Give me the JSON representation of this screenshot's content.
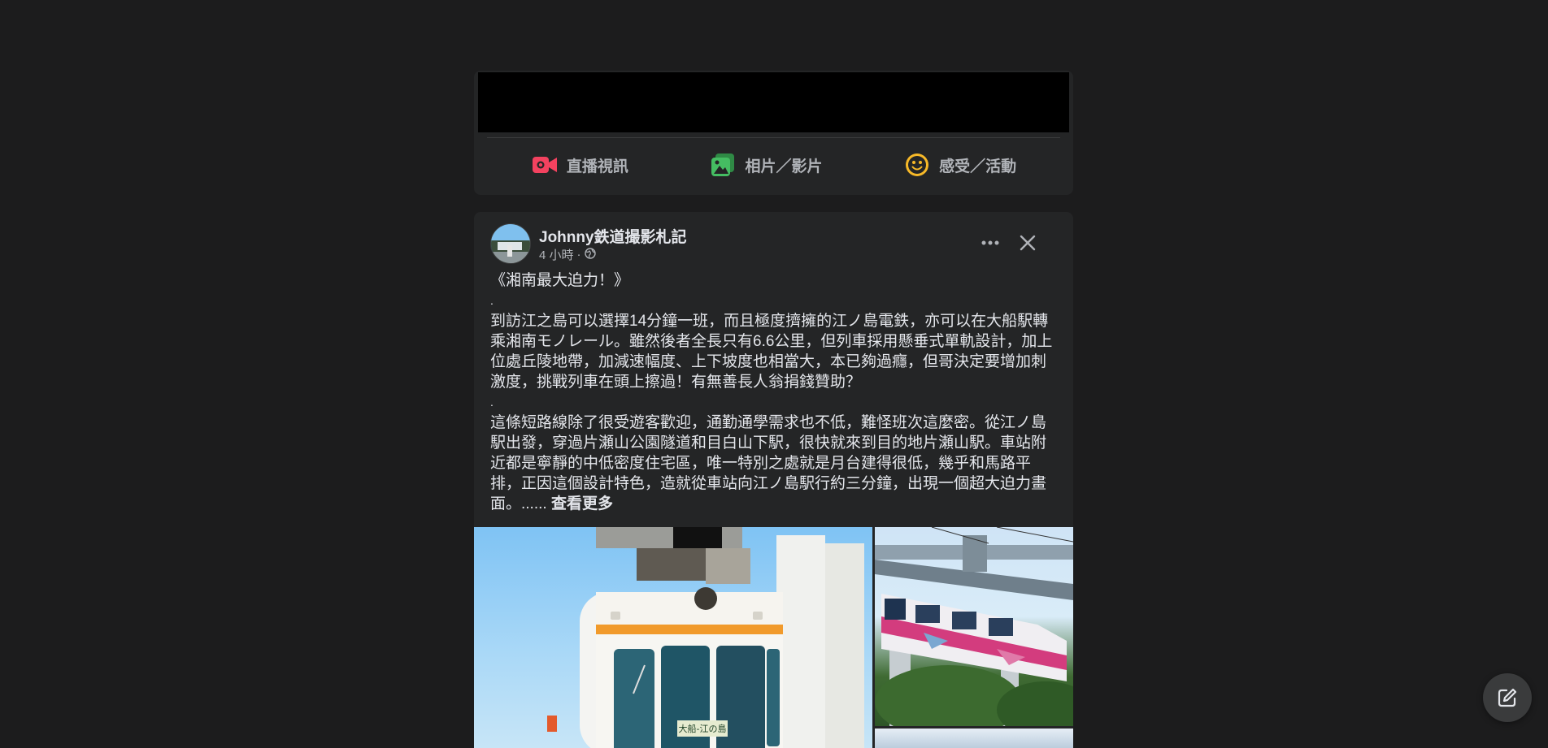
{
  "composer": {
    "actions": [
      {
        "label": "直播視訊",
        "icon": "live-video-icon"
      },
      {
        "label": "相片／影片",
        "icon": "photo-video-icon"
      },
      {
        "label": "感受／活動",
        "icon": "feeling-activity-icon"
      }
    ]
  },
  "post": {
    "author": "Johnny鉄道撮影札記",
    "time": "4 小時",
    "separator": "·",
    "privacy_icon": "globe-icon",
    "paragraphs": [
      "《湘南最大迫力！》",
      ".",
      "到訪江之島可以選擇14分鐘一班，而且極度擠擁的江ノ島電鉄，亦可以在大船駅轉乘湘南モノレール。雖然後者全長只有6.6公里，但列車採用懸垂式單軌設計，加上位處丘陵地帶，加減速幅度、上下坡度也相當大，本已夠過癮，但哥決定要增加刺激度，挑戰列車在頭上擦過！有無善長人翁捐錢贊助？",
      ".",
      "這條短路線除了很受遊客歡迎，通勤通學需求也不低，難怪班次這麼密。從江ノ島駅出發，穿過片瀬山公園隧道和目白山下駅，很快就來到目的地片瀬山駅。車站附近都是寧靜的中低密度住宅區，唯一特別之處就是月台建得很低，幾乎和馬路平排，正因這個設計特色，造就從車站向江ノ島駅行約三分鐘，出現一個超大迫力畫面。......"
    ],
    "see_more": "查看更多",
    "more_icon": "more-options-icon",
    "close_icon": "close-icon",
    "photo_sign": "大船-江の島"
  },
  "colors": {
    "background": "#1c1c1d",
    "card": "#242526",
    "text_primary": "#e4e6eb",
    "text_secondary": "#b0b3b8",
    "live_red": "#f3425f",
    "photo_green": "#45bd62",
    "feeling_yellow": "#f7b928"
  },
  "fab_icon": "compose-icon"
}
